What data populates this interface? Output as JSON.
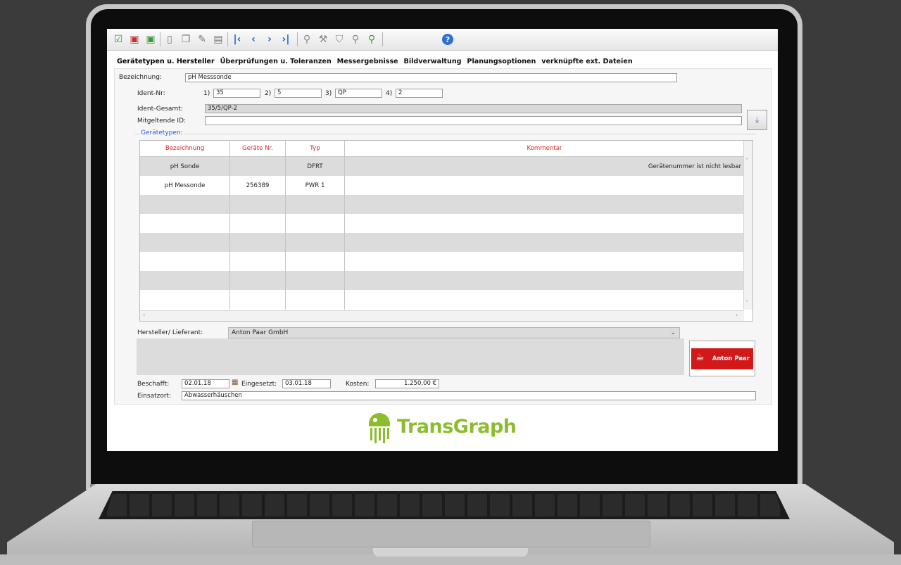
{
  "toolbar": {
    "icons": [
      "save-check-icon",
      "delete-icon",
      "confirm-icon",
      "new-doc-icon",
      "copy-doc-icon",
      "edit-doc-icon",
      "print-doc-icon",
      "first-record-icon",
      "prev-record-icon",
      "next-record-icon",
      "last-record-icon",
      "search-icon",
      "tools-icon",
      "filter-icon",
      "zoom-icon",
      "find-icon",
      "help-icon"
    ]
  },
  "tabs": [
    {
      "label": "Gerätetypen u. Hersteller",
      "active": true
    },
    {
      "label": "Überprüfungen u. Toleranzen"
    },
    {
      "label": "Messergebnisse"
    },
    {
      "label": "Bildverwaltung"
    },
    {
      "label": "Planungsoptionen"
    },
    {
      "label": "verknüpfte ext. Dateien"
    }
  ],
  "form": {
    "bezeichnung_label": "Bezeichnung:",
    "bezeichnung_value": "pH Messsonde",
    "ident_label": "Ident-Nr:",
    "ident": [
      {
        "prefix": "1)",
        "value": "35"
      },
      {
        "prefix": "2)",
        "value": "5"
      },
      {
        "prefix": "3)",
        "value": "QP"
      },
      {
        "prefix": "4)",
        "value": "2"
      }
    ],
    "ident_gesamt_label": "Ident-Gesamt:",
    "ident_gesamt_value": "35/5/QP-2",
    "mitgeltende_label": "Mitgeltende ID:",
    "mitgeltende_value": "",
    "geraetetypen_legend": "Gerätetypen:"
  },
  "table": {
    "headers": [
      "Bezeichnung",
      "Geräte Nr.",
      "Typ",
      "Kommentar"
    ],
    "rows": [
      {
        "bezeichnung": "pH Sonde",
        "nr": "",
        "typ": "DFRT",
        "kommentar": "Gerätenummer ist nicht lesbar"
      },
      {
        "bezeichnung": "pH Messonde",
        "nr": "256389",
        "typ": "PWR 1",
        "kommentar": ""
      }
    ]
  },
  "manufacturer": {
    "label": "Hersteller/ Lieferant:",
    "value": "Anton Paar GmbH",
    "logo_text": "Anton Paar"
  },
  "purchase": {
    "beschafft_label": "Beschafft:",
    "beschafft_value": "02.01.18",
    "eingesetzt_label": "Eingesetzt:",
    "eingesetzt_value": "03.01.18",
    "kosten_label": "Kosten:",
    "kosten_value": "1.250,00 €",
    "einsatzort_label": "Einsatzort:",
    "einsatzort_value": "Abwasserhäuschen"
  },
  "brand": {
    "name": "TransGraph",
    "color": "#8cbd2e"
  }
}
